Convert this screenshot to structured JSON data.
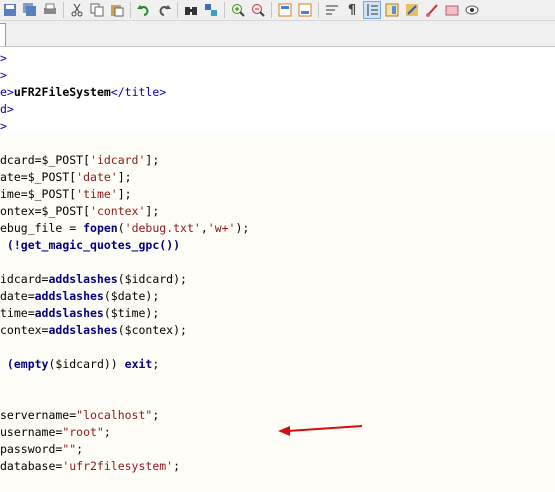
{
  "toolbar": {
    "buttons": [
      "save-icon",
      "save-all-icon",
      "print-icon",
      "cut-icon",
      "copy-icon",
      "paste-icon",
      "undo-icon",
      "redo-icon",
      "find-icon",
      "replace-icon",
      "zoom-in-icon",
      "zoom-out-icon",
      "sync-vertical-icon",
      "sync-horizontal-icon",
      "word-wrap-icon",
      "show-all-chars-icon",
      "indent-guide-icon",
      "doc-map-icon",
      "function-list-icon",
      "folder-as-workspace-icon",
      "monitoring-icon",
      "preview-icon"
    ],
    "active": "indent-guide-icon"
  },
  "code": {
    "l1": ">",
    "l2": ">",
    "l3_a": "e>",
    "l3_b": "uFR2FileSystem",
    "l3_c": "</title>",
    "l4": "d>",
    "l5": ">",
    "l6_a": "dcard=$_POST[",
    "l6_b": "'idcard'",
    "l6_c": "];",
    "l7_a": "ate=$_POST[",
    "l7_b": "'date'",
    "l7_c": "];",
    "l8_a": "ime=$_POST[",
    "l8_b": "'time'",
    "l8_c": "];",
    "l9_a": "ontex=$_POST[",
    "l9_b": "'contex'",
    "l9_c": "];",
    "l10_a": "ebug_file = ",
    "l10_b": "fopen",
    "l10_c": "(",
    "l10_d": "'debug.txt'",
    "l10_e": ",",
    "l10_f": "'w+'",
    "l10_g": ");",
    "l11_a": " (!",
    "l11_b": "get_magic_quotes_gpc",
    "l11_c": "())",
    "l12_a": "idcard=",
    "l12_b": "addslashes",
    "l12_c": "($idcard);",
    "l13_a": "date=",
    "l13_b": "addslashes",
    "l13_c": "($date);",
    "l14_a": "time=",
    "l14_b": "addslashes",
    "l14_c": "($time);",
    "l15_a": "contex=",
    "l15_b": "addslashes",
    "l15_c": "($contex);",
    "l16_a": " (",
    "l16_b": "empty",
    "l16_c": "($idcard)) ",
    "l16_d": "exit",
    "l16_e": ";",
    "l17_a": "servername=",
    "l17_b": "\"localhost\"",
    "l17_c": ";",
    "l18_a": "username=",
    "l18_b": "\"root\"",
    "l18_c": ";",
    "l19_a": "password=",
    "l19_b": "\"\"",
    "l19_c": ";",
    "l20_a": "database=",
    "l20_b": "'ufr2filesystem'",
    "l20_c": ";"
  },
  "colors": {
    "annotation_arrow": "#d01010",
    "php_background": "#fffdf7"
  }
}
